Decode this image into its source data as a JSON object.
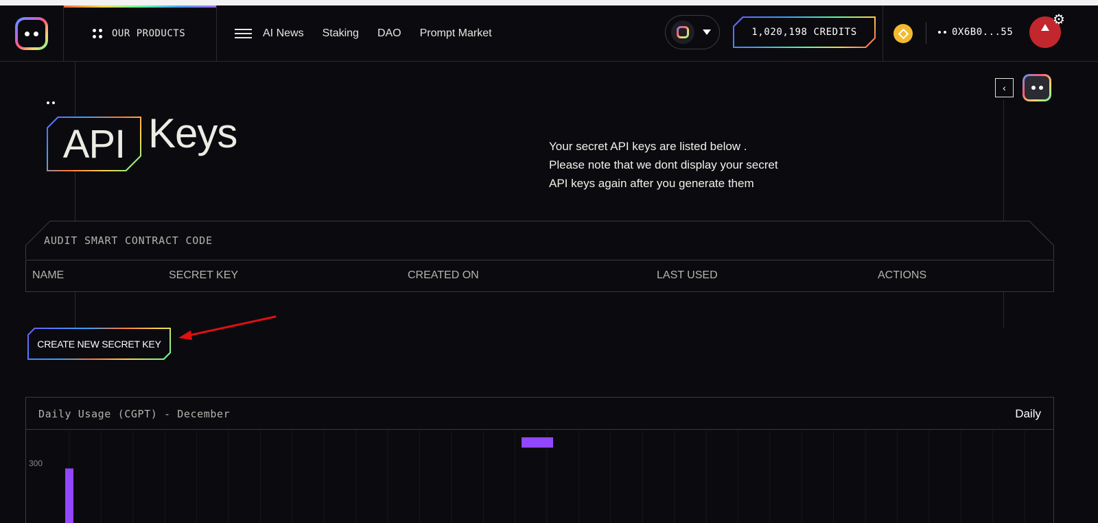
{
  "header": {
    "products_label": "OUR PRODUCTS",
    "nav": [
      "AI News",
      "Staking",
      "DAO",
      "Prompt Market"
    ],
    "credits": "1,020,198 CREDITS",
    "wallet": "0X6B0...55"
  },
  "page": {
    "title_boxed": "API",
    "title_rest": "Keys",
    "description_lines": [
      "Your secret API keys are listed below .",
      "Please note that we dont display your secret",
      "API keys again after you generate them"
    ]
  },
  "keys_table": {
    "title": "AUDIT SMART CONTRACT CODE",
    "columns": [
      "NAME",
      "SECRET KEY",
      "CREATED ON",
      "LAST USED",
      "ACTIONS"
    ]
  },
  "create_button": "CREATE NEW SECRET KEY",
  "usage": {
    "title": "Daily Usage (CGPT) - December",
    "mode": "Daily"
  },
  "colors": {
    "bar": "#9146ff",
    "arrow": "#e01010",
    "avatar": "#c1272d",
    "bnb": "#f3ba2f"
  },
  "chart_data": {
    "type": "bar",
    "title": "Daily Usage (CGPT) - December",
    "y_tick_labels": [
      "300"
    ],
    "y_ticks": [
      300
    ],
    "bars": [
      {
        "slot": 1,
        "value": 275
      },
      {
        "slot": 16,
        "value": 430
      }
    ],
    "ylim": [
      0,
      430
    ],
    "grid": true
  }
}
